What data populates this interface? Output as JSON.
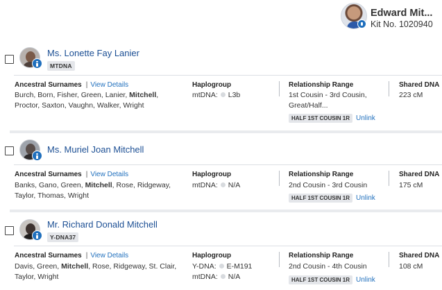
{
  "user": {
    "name": "Edward Mit...",
    "kit": "Kit No. 1020940"
  },
  "columns": {
    "ancestral": "Ancestral Surnames",
    "view_details": "View Details",
    "haplogroup": "Haplogroup",
    "relationship": "Relationship Range",
    "shared": "Shared DNA",
    "unlink": "Unlink"
  },
  "matches": [
    {
      "name": "Ms. Lonette Fay Lanier",
      "test_tag": "MTDNA",
      "surnames_line1": [
        "Burch, Born, Fisher, Green, Lanier, ",
        "Mitchell",
        ","
      ],
      "surnames_line2": "Proctor, Saxton, Vaughn, Walker, Wright",
      "haplo": [
        {
          "label": "mtDNA:",
          "value": "L3b"
        }
      ],
      "relationship_line1": "1st Cousin - 3rd Cousin,",
      "relationship_line2": "Great/Half...",
      "rel_tag": "HALF 1ST COUSIN 1R",
      "shared": "223 cM"
    },
    {
      "name": "Ms. Muriel Joan Mitchell",
      "test_tag": "",
      "surnames_line1": [
        "Banks, Gano, Green, ",
        "Mitchell",
        ", Rose, Ridgeway,"
      ],
      "surnames_line2": "Taylor, Thomas, Wright",
      "haplo": [
        {
          "label": "mtDNA:",
          "value": "N/A"
        }
      ],
      "relationship_line1": "2nd Cousin - 3rd Cousin",
      "relationship_line2": "",
      "rel_tag": "HALF 1ST COUSIN 1R",
      "shared": "175 cM"
    },
    {
      "name": "Mr. Richard Donald Mitchell",
      "test_tag": "Y-DNA37",
      "surnames_line1": [
        "Davis, Green, ",
        "Mitchell",
        ", Rose, Ridgeway, St. Clair,"
      ],
      "surnames_line2": "Taylor, Wright",
      "haplo": [
        {
          "label": "Y-DNA:",
          "value": "E-M191"
        },
        {
          "label": "mtDNA:",
          "value": "N/A"
        }
      ],
      "relationship_line1": "2nd Cousin - 4th Cousin",
      "relationship_line2": "",
      "rel_tag": "HALF 1ST COUSIN 1R",
      "shared": "108 cM"
    }
  ]
}
